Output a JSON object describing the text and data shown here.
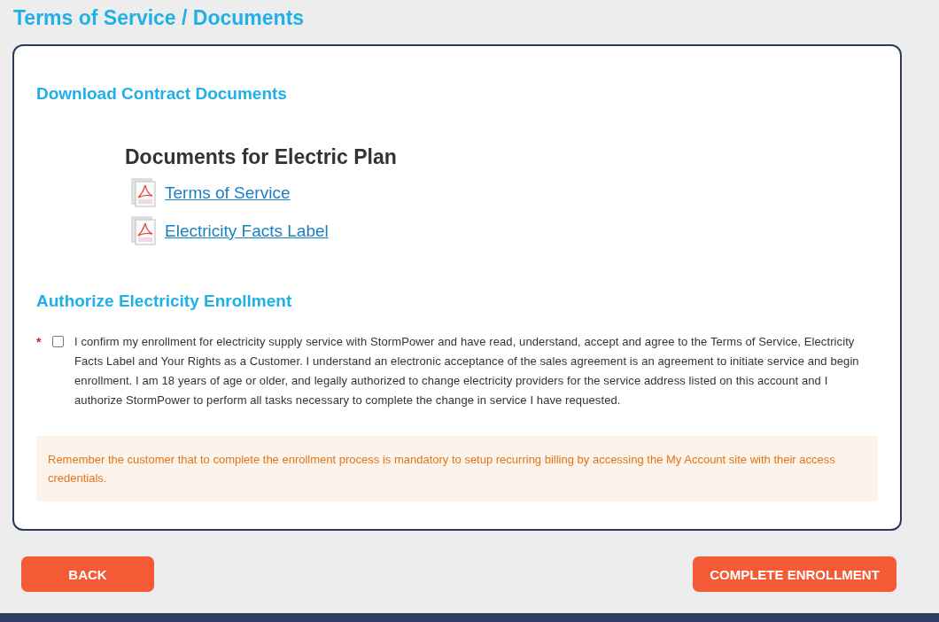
{
  "page_title": "Terms of Service / Documents",
  "download_section": {
    "heading": "Download Contract Documents",
    "group_title": "Documents for Electric Plan",
    "documents": [
      {
        "label": "Terms of Service"
      },
      {
        "label": "Electricity Facts Label"
      }
    ]
  },
  "authorize_section": {
    "heading": "Authorize Electricity Enrollment",
    "required_mark": "*",
    "checked": false,
    "consent_text": "I confirm my enrollment for electricity supply service with StormPower and have read, understand, accept and agree to the Terms of Service, Electricity Facts Label and Your Rights as a Customer. I understand an electronic acceptance of the sales agreement is an agreement to initiate service and begin enrollment. I am 18 years of age or older, and legally authorized to change electricity providers for the service address listed on this account and I authorize StormPower to perform all tasks necessary to complete the change in service I have requested."
  },
  "notice": "Remember the customer that to complete the enrollment process is mandatory to setup recurring billing by accessing the My Account site with their access credentials.",
  "buttons": [
    {
      "label": "BACK"
    },
    {
      "label": "COMPLETE ENROLLMENT"
    }
  ]
}
